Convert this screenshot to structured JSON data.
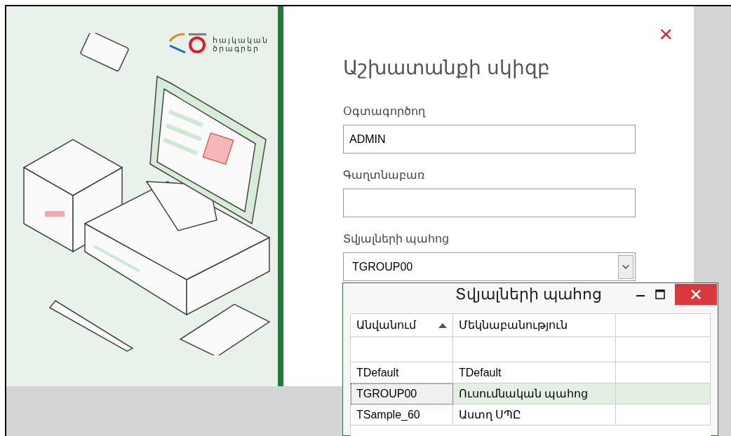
{
  "logo": {
    "line_1": "հայկական",
    "line_2": "ծրագրեր"
  },
  "login": {
    "title": "Աշխատանքի սկիզբ",
    "close": "×",
    "fields": [
      {
        "kind": "text",
        "label": "Օգտագործող",
        "value": "ADMIN"
      },
      {
        "kind": "password",
        "label": "Գաղտնաբառ"
      },
      {
        "kind": "combo",
        "label": "Տվյալների պահոց",
        "value": "TGROUP00"
      }
    ]
  },
  "popup": {
    "title": "Տվյալների պահոց",
    "columns": [
      {
        "label": "Անվանում",
        "sorted": true
      },
      {
        "label": "Մեկնաբանություն",
        "sorted": false
      }
    ],
    "rows": [
      {
        "name": "TDefault",
        "comment": "TDefault",
        "selected": false
      },
      {
        "name": "TGROUP00",
        "comment": "Ուսումնական պահոց",
        "selected": true
      },
      {
        "name": "TSample_60",
        "comment": "Աստղ ՍՊԸ",
        "selected": false
      }
    ]
  }
}
